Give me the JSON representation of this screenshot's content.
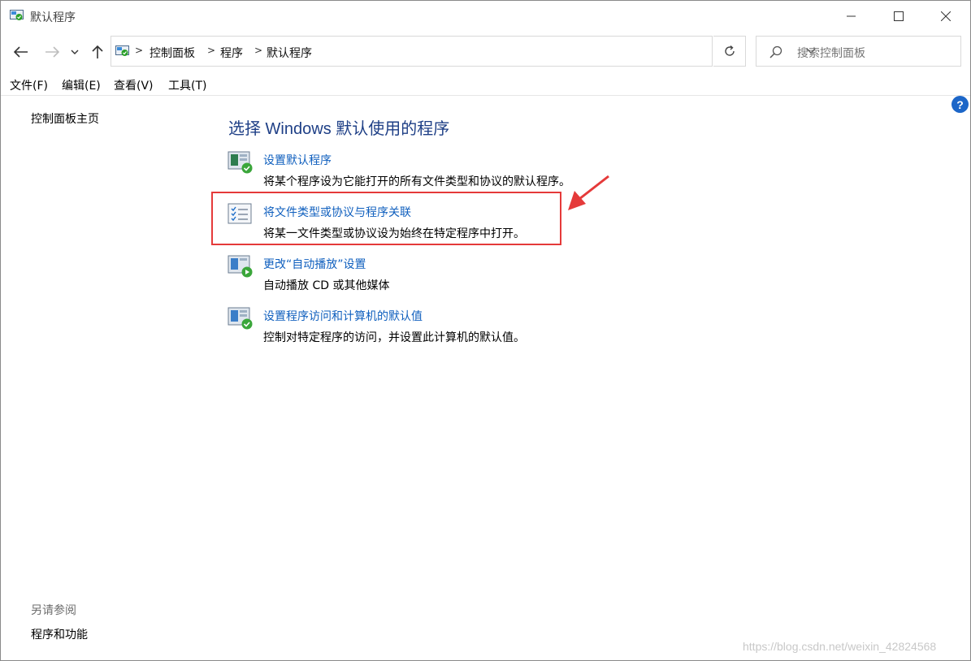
{
  "window": {
    "title": "默认程序",
    "min_label": "—",
    "max_label": "☐",
    "close_label": "✕"
  },
  "address": {
    "breadcrumbs": [
      "控制面板",
      "程序",
      "默认程序"
    ],
    "separator": ">",
    "search_placeholder": "搜索控制面板"
  },
  "menu": [
    "文件(F)",
    "编辑(E)",
    "查看(V)",
    "工具(T)"
  ],
  "sidebar": {
    "home_link": "控制面板主页",
    "see_also_heading": "另请参阅",
    "see_also_link": "程序和功能"
  },
  "help_label": "?",
  "main": {
    "title": "选择 Windows 默认使用的程序",
    "items": [
      {
        "link": "设置默认程序",
        "desc": "将某个程序设为它能打开的所有文件类型和协议的默认程序。",
        "icon": "default-programs-icon"
      },
      {
        "link": "将文件类型或协议与程序关联",
        "desc": "将某一文件类型或协议设为始终在特定程序中打开。",
        "icon": "file-association-icon"
      },
      {
        "link": "更改“自动播放”设置",
        "desc": "自动播放 CD 或其他媒体",
        "icon": "autoplay-icon"
      },
      {
        "link": "设置程序访问和计算机的默认值",
        "desc": "控制对特定程序的访问，并设置此计算机的默认值。",
        "icon": "program-access-icon"
      }
    ]
  },
  "watermark": "https://blog.csdn.net/weixin_42824568",
  "colors": {
    "link": "#0f5fbe",
    "title": "#1e3f86",
    "highlight": "#e53a3a",
    "help": "#1c66c8"
  }
}
